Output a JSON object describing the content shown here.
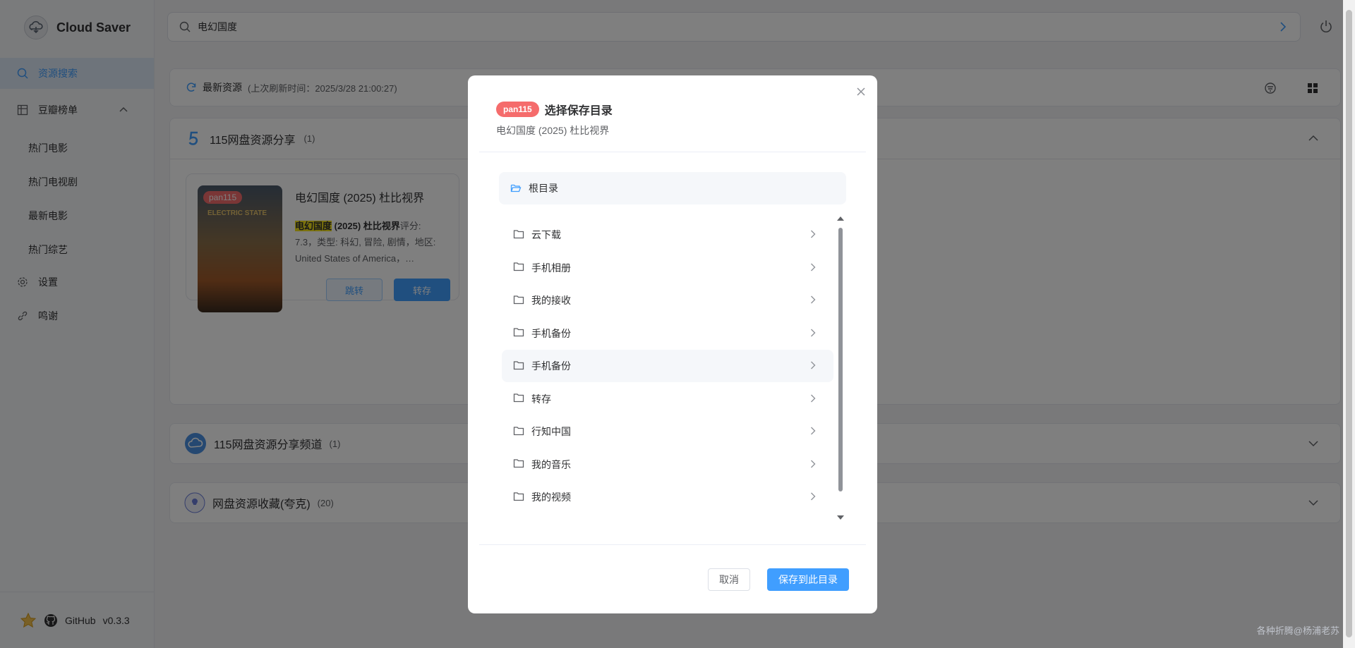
{
  "app": {
    "title": "Cloud Saver",
    "version": "v0.3.3",
    "github_label": "GitHub"
  },
  "sidebar": {
    "items": [
      {
        "label": "资源搜索",
        "icon": "search-icon"
      },
      {
        "label": "豆瓣榜单",
        "icon": "grid-icon"
      },
      {
        "label": "设置",
        "icon": "gear-icon"
      },
      {
        "label": "鸣谢",
        "icon": "link-icon"
      }
    ],
    "sub_items": [
      "热门电影",
      "热门电视剧",
      "最新电影",
      "热门综艺"
    ]
  },
  "search": {
    "value": "电幻国度"
  },
  "latest": {
    "label": "最新资源",
    "sub": "(上次刷新时间：2025/3/28 21:00:27)"
  },
  "section_main": {
    "title": "115网盘资源分享",
    "count": "(1)",
    "card": {
      "tag": "pan115",
      "title": "电幻国度 (2025) 杜比视界",
      "desc_highlight": "电幻国度",
      "desc_bold": " (2025) 杜比视界",
      "desc_rest": "评分: 7.3，类型: 科幻, 冒险, 剧情，地区: United States of America，…",
      "poster_text": "ELECTRIC STATE",
      "btn_jump": "跳转",
      "btn_save": "转存"
    }
  },
  "section_channel": {
    "title": "115网盘资源分享频道",
    "count": "(1)"
  },
  "section_collect": {
    "title": "网盘资源收藏(夸克)",
    "count": "(20)"
  },
  "watermark": "各种折腾@杨浦老苏",
  "dialog": {
    "tag": "pan115",
    "title": "选择保存目录",
    "subtitle": "电幻国度 (2025) 杜比视界",
    "root": "根目录",
    "folders": [
      "云下载",
      "手机相册",
      "我的接收",
      "手机备份",
      "手机备份",
      "转存",
      "行知中国",
      "我的音乐",
      "我的视频"
    ],
    "cancel": "取消",
    "confirm": "保存到此目录"
  },
  "colors": {
    "primary": "#409eff",
    "tag_red": "#f56c6c",
    "highlight": "#f7e41a"
  }
}
